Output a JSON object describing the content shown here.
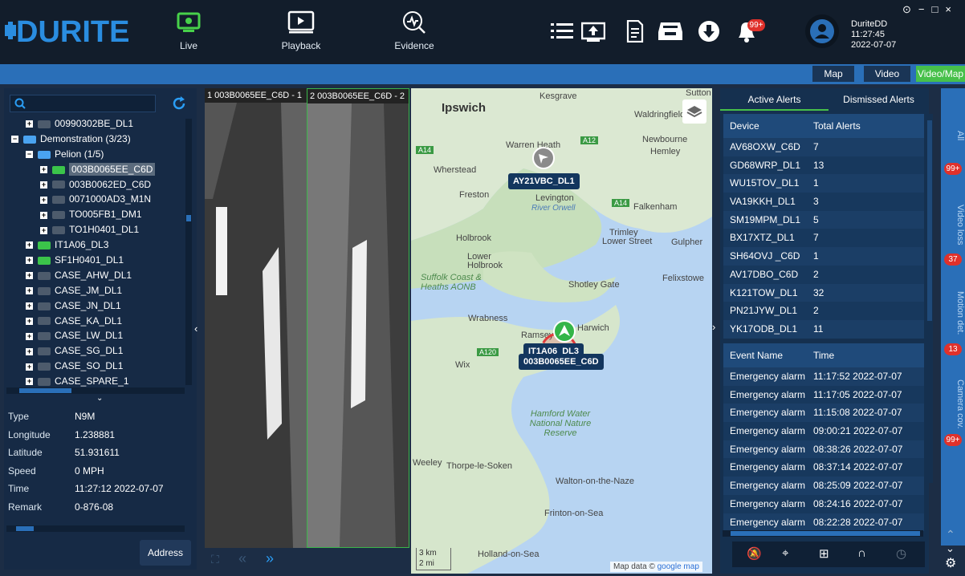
{
  "app": {
    "brand": "DURITE",
    "user": "DuriteDD",
    "time": "11:27:45",
    "date": "2022-07-07"
  },
  "nav": [
    {
      "label": "Live"
    },
    {
      "label": "Playback"
    },
    {
      "label": "Evidence"
    }
  ],
  "notif_badge": "99+",
  "window_controls": [
    "⊙",
    "−",
    "□",
    "×"
  ],
  "view_tabs": [
    "Map",
    "Video",
    "Video/Map"
  ],
  "tree": [
    {
      "label": "00990302BE_DL1",
      "indent": 1,
      "icon": "gray"
    },
    {
      "label": "Demonstration (3/23)",
      "indent": 0,
      "icon": "group",
      "expand": "−"
    },
    {
      "label": "Pelion (1/5)",
      "indent": 1,
      "icon": "group",
      "expand": "−"
    },
    {
      "label": "003B0065EE_C6D",
      "indent": 2,
      "icon": "green",
      "selected": true
    },
    {
      "label": "003B0062ED_C6D",
      "indent": 2,
      "icon": "gray"
    },
    {
      "label": "0071000AD3_M1N",
      "indent": 2,
      "icon": "gray"
    },
    {
      "label": "TO005FB1_DM1",
      "indent": 2,
      "icon": "gray"
    },
    {
      "label": "TO1H0401_DL1",
      "indent": 2,
      "icon": "gray"
    },
    {
      "label": "IT1A06_DL3",
      "indent": 1,
      "icon": "green"
    },
    {
      "label": "SF1H0401_DL1",
      "indent": 1,
      "icon": "green"
    },
    {
      "label": "CASE_AHW_DL1",
      "indent": 1,
      "icon": "gray"
    },
    {
      "label": "CASE_JM_DL1",
      "indent": 1,
      "icon": "gray"
    },
    {
      "label": "CASE_JN_DL1",
      "indent": 1,
      "icon": "gray"
    },
    {
      "label": "CASE_KA_DL1",
      "indent": 1,
      "icon": "gray"
    },
    {
      "label": "CASE_LW_DL1",
      "indent": 1,
      "icon": "gray"
    },
    {
      "label": "CASE_SG_DL1",
      "indent": 1,
      "icon": "gray"
    },
    {
      "label": "CASE_SO_DL1",
      "indent": 1,
      "icon": "gray"
    },
    {
      "label": "CASE_SPARE_1",
      "indent": 1,
      "icon": "gray"
    }
  ],
  "props": [
    {
      "k": "Type",
      "v": "N9M"
    },
    {
      "k": "Longitude",
      "v": "1.238881"
    },
    {
      "k": "Latitude",
      "v": "51.931611"
    },
    {
      "k": "Speed",
      "v": "0 MPH"
    },
    {
      "k": "Time",
      "v": "11:27:12 2022-07-07"
    },
    {
      "k": "Remark",
      "v": "0-876-08"
    }
  ],
  "address_btn": "Address",
  "video": {
    "ch1": "1 003B0065EE_C6D - 1",
    "ch2": "2 003B0065EE_C6D - 2"
  },
  "map": {
    "places": [
      "Ipswich",
      "Kesgrave",
      "Sutton",
      "Waldringfield",
      "Newbourne",
      "Hemley",
      "Warren Heath",
      "Wherstead",
      "Freston",
      "Levington",
      "River Orwell",
      "Falkenham",
      "Trimley",
      "Lower Street",
      "Gulpher",
      "Holbrook",
      "Lower Holbrook",
      "Suffolk Coast & Heaths AONB",
      "Shotley Gate",
      "Felixstowe",
      "Wrabness",
      "Ramsey",
      "Harwich",
      "Wix",
      "Hamford Water National Nature Reserve",
      "Weeley",
      "Thorpe-le-Soken",
      "Walton-on-the-Naze",
      "Frinton-on-Sea",
      "Holland-on-Sea"
    ],
    "roads": [
      "A14",
      "A12",
      "A14",
      "A120"
    ],
    "markers": [
      "AY21VBC_DL1",
      "IT1A06_DL3",
      "003B0065EE_C6D"
    ],
    "scale": [
      "3 km",
      "2 mi"
    ],
    "credit": "Map data ©",
    "google": "google map"
  },
  "alerts": {
    "tabs": [
      "Active Alerts",
      "Dismissed Alerts"
    ],
    "head": [
      "Device",
      "Total Alerts"
    ],
    "rows": [
      [
        "AV68OXW_C6D",
        "7"
      ],
      [
        "GD68WRP_DL1",
        "13"
      ],
      [
        "WU15TOV_DL1",
        "1"
      ],
      [
        "VA19KKH_DL1",
        "3"
      ],
      [
        "SM19MPM_DL1",
        "5"
      ],
      [
        "BX17XTZ_DL1",
        "7"
      ],
      [
        "SH64OVJ _C6D",
        "1"
      ],
      [
        "AV17DBO_C6D",
        "2"
      ],
      [
        "K121TOW_DL1",
        "32"
      ],
      [
        "PN21JYW_DL1",
        "2"
      ],
      [
        "YK17ODB_DL1",
        "11"
      ]
    ]
  },
  "events": {
    "head": [
      "Event Name",
      "Time"
    ],
    "rows": [
      [
        "Emergency alarm",
        "11:17:52 2022-07-07"
      ],
      [
        "Emergency alarm",
        "11:17:05 2022-07-07"
      ],
      [
        "Emergency alarm",
        "11:15:08 2022-07-07"
      ],
      [
        "Emergency alarm",
        "09:00:21 2022-07-07"
      ],
      [
        "Emergency alarm",
        "08:38:26 2022-07-07"
      ],
      [
        "Emergency alarm",
        "08:37:14 2022-07-07"
      ],
      [
        "Emergency alarm",
        "08:25:09 2022-07-07"
      ],
      [
        "Emergency alarm",
        "08:24:16 2022-07-07"
      ],
      [
        "Emergency alarm",
        "08:22:28 2022-07-07"
      ]
    ]
  },
  "side_tabs": [
    {
      "label": "All",
      "badge": "99+"
    },
    {
      "label": "Video loss",
      "badge": "37"
    },
    {
      "label": "Motion det.",
      "badge": "13"
    },
    {
      "label": "Camera cov.",
      "badge": "99+"
    }
  ]
}
